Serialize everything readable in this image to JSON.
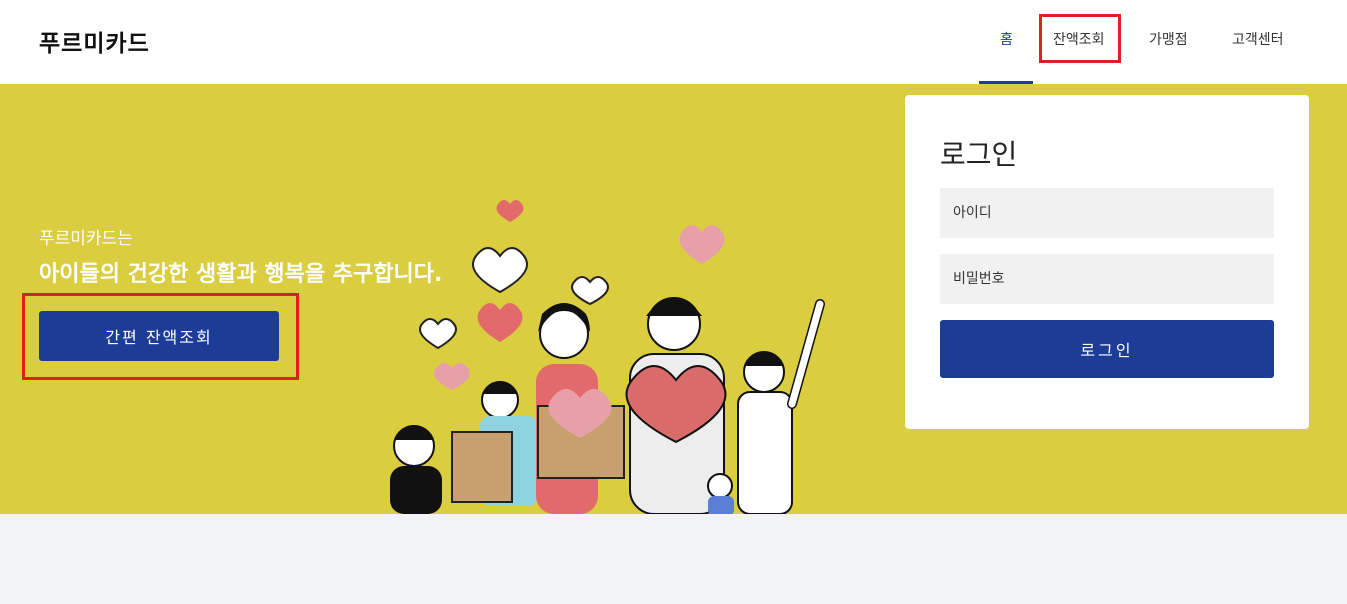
{
  "header": {
    "logo": "푸르미카드",
    "nav": [
      {
        "label": "홈"
      },
      {
        "label": "잔액조회"
      },
      {
        "label": "가맹점"
      },
      {
        "label": "고객센터"
      }
    ]
  },
  "hero": {
    "subtitle": "푸르미카드는",
    "title": "아이들의 건강한 생활과 행복을 추구합니다.",
    "quick_button": "간편 잔액조회"
  },
  "login": {
    "title": "로그인",
    "id_placeholder": "아이디",
    "pw_placeholder": "비밀번호",
    "submit_label": "로그인"
  },
  "colors": {
    "accent": "#1c3c98",
    "hero_bg": "#dbcd40",
    "highlight": "#e02020"
  }
}
